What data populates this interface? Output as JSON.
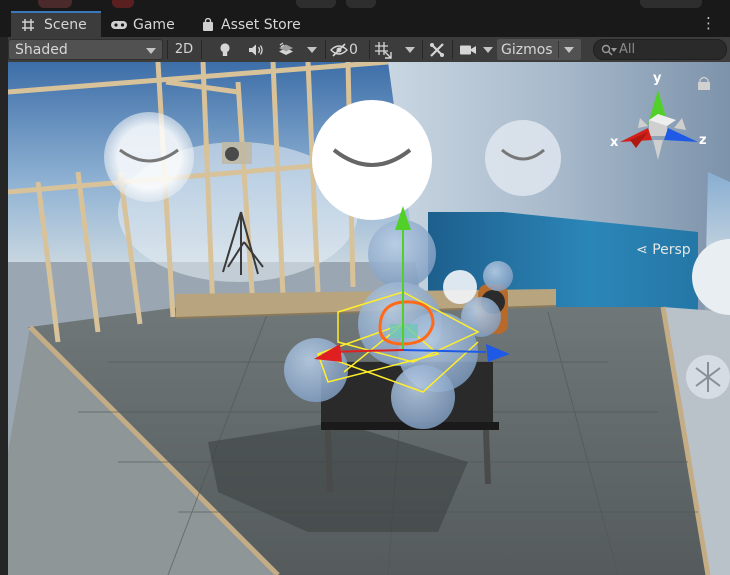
{
  "tabs": [
    {
      "label": "Scene",
      "icon": "grid-icon",
      "active": true
    },
    {
      "label": "Game",
      "icon": "gamepad-icon",
      "active": false
    },
    {
      "label": "Asset Store",
      "icon": "shopping-bag-icon",
      "active": false
    }
  ],
  "toolbar": {
    "draw_mode": "Shaded",
    "toggle_2d": "2D",
    "hidden_count": "0",
    "gizmos_label": "Gizmos",
    "search_placeholder": "All"
  },
  "orientation_gizmo": {
    "x_label": "x",
    "y_label": "y",
    "z_label": "z",
    "projection_label": "Persp"
  },
  "colors": {
    "accent": "#3a79bb",
    "axis_x": "#e02020",
    "axis_y": "#52d02a",
    "axis_z": "#1e5ae6",
    "selection": "#ff6a1a"
  }
}
